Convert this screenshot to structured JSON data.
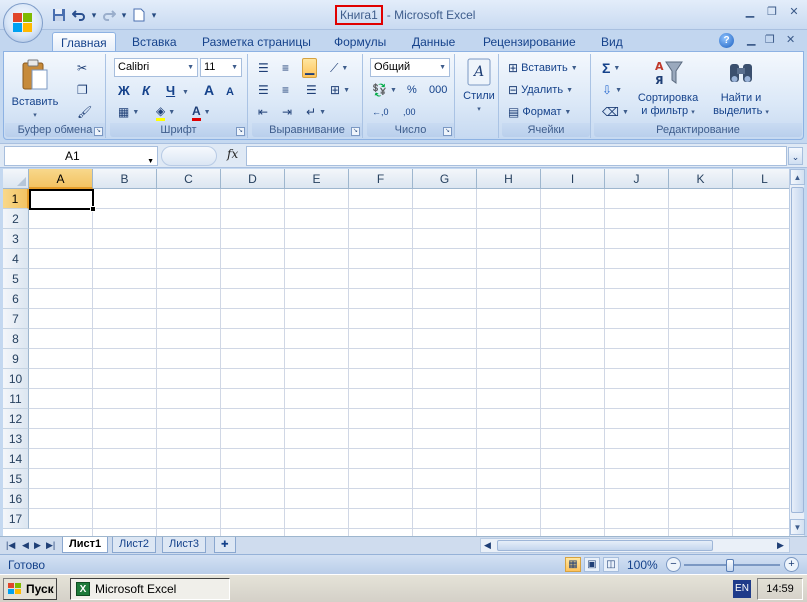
{
  "window": {
    "doc_name": "Книга1",
    "app_name": "- Microsoft Excel",
    "qat": {
      "save": "save-icon",
      "undo": "undo-icon",
      "redo": "redo-icon",
      "new": "new-doc-icon",
      "customize": "▾"
    }
  },
  "tabs": [
    "Главная",
    "Вставка",
    "Разметка страницы",
    "Формулы",
    "Данные",
    "Рецензирование",
    "Вид"
  ],
  "active_tab": "Главная",
  "ribbon": {
    "clipboard": {
      "label": "Буфер обмена",
      "paste": "Вставить"
    },
    "font": {
      "label": "Шрифт",
      "name": "Calibri",
      "size": "11",
      "bold": "Ж",
      "italic": "К",
      "underline": "Ч",
      "grow": "A",
      "shrink": "A"
    },
    "alignment": {
      "label": "Выравнивание"
    },
    "number": {
      "label": "Число",
      "format": "Общий",
      "percent": "%",
      "thousands": "000",
      "inc_dec": "←,0",
      "dec_dec": ",00"
    },
    "styles": {
      "label": "Стили"
    },
    "cells": {
      "label": "Ячейки",
      "insert": "Вставить",
      "delete": "Удалить",
      "format": "Формат"
    },
    "editing": {
      "label": "Редактирование",
      "sum": "Σ",
      "sort_line1": "Сортировка",
      "sort_line2": "и фильтр",
      "find_line1": "Найти и",
      "find_line2": "выделить"
    }
  },
  "formula_bar": {
    "name_box": "A1",
    "fx": "fx",
    "value": ""
  },
  "sheet": {
    "columns": [
      "A",
      "B",
      "C",
      "D",
      "E",
      "F",
      "G",
      "H",
      "I",
      "J",
      "K",
      "L"
    ],
    "rows": [
      "1",
      "2",
      "3",
      "4",
      "5",
      "6",
      "7",
      "8",
      "9",
      "10",
      "11",
      "12",
      "13",
      "14",
      "15",
      "16",
      "17"
    ],
    "active_cell": "A1"
  },
  "sheet_tabs": [
    "Лист1",
    "Лист2",
    "Лист3"
  ],
  "active_sheet": "Лист1",
  "status": {
    "text": "Готово",
    "zoom": "100%"
  },
  "taskbar": {
    "start": "Пуск",
    "task": "Microsoft Excel",
    "lang": "EN",
    "time": "14:59"
  },
  "colors": {
    "ribbon_blue": "#dbe8f7",
    "highlight": "#ffc35a",
    "selection_border": "#e00000"
  }
}
